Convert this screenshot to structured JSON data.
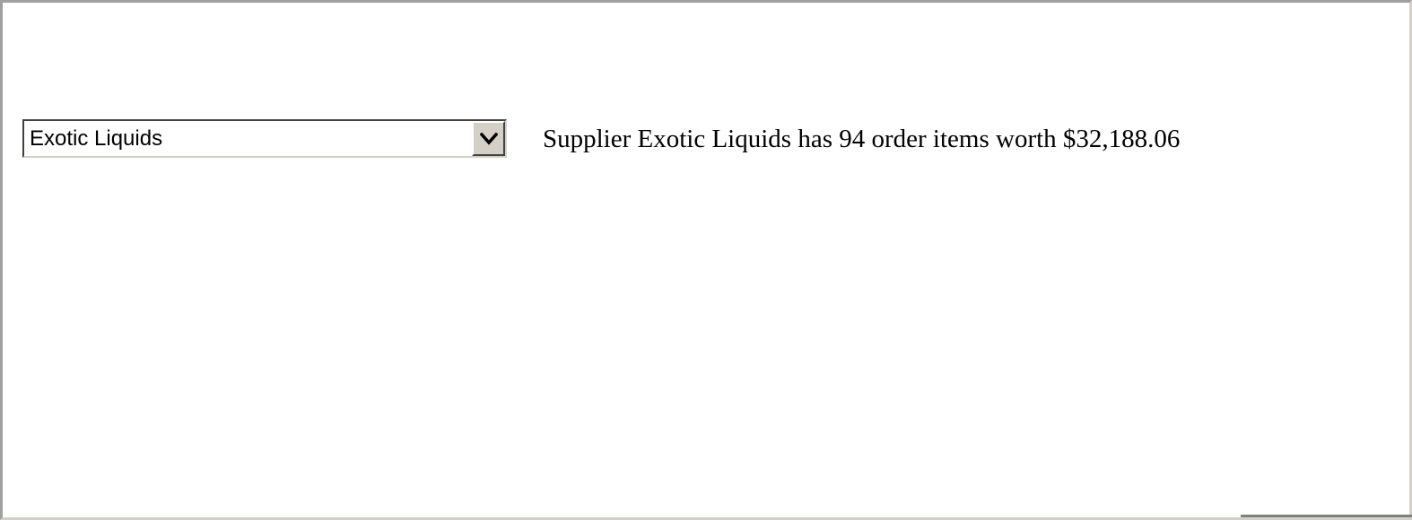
{
  "supplier_select": {
    "selected_value": "Exotic Liquids",
    "arrow_icon": "chevron-down-icon"
  },
  "summary": {
    "text": "Supplier Exotic Liquids has 94 order items worth $32,188.06"
  }
}
